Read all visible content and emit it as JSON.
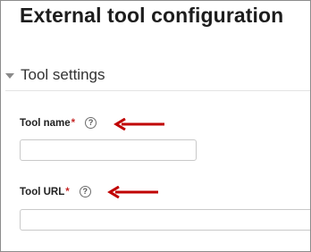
{
  "page": {
    "title": "External tool configuration"
  },
  "section": {
    "title": "Tool settings"
  },
  "fields": [
    {
      "label": "Tool name",
      "required": "*",
      "help": "?",
      "value": "",
      "placeholder": ""
    },
    {
      "label": "Tool URL",
      "required": "*",
      "help": "?",
      "value": "",
      "placeholder": ""
    }
  ],
  "colors": {
    "required": "#c62828",
    "arrow": "#c00000",
    "border": "#c9c9c9"
  }
}
